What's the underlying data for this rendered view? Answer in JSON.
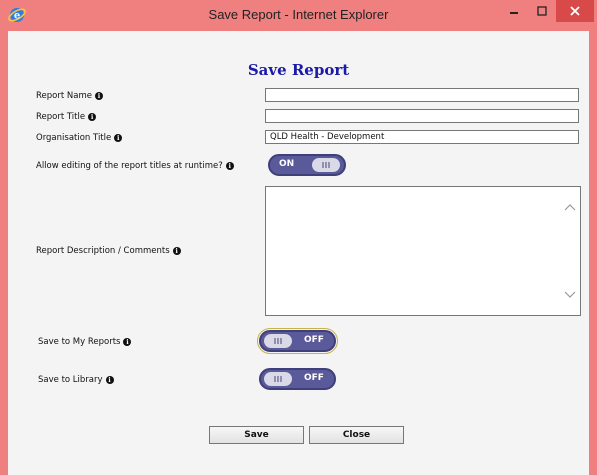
{
  "window": {
    "title": "Save Report - Internet Explorer",
    "frame_color": "#f08080",
    "close_color": "#d84a4a"
  },
  "form": {
    "title": "Save Report",
    "fields": {
      "report_name": {
        "label": "Report Name",
        "value": ""
      },
      "report_title": {
        "label": "Report Title",
        "value": ""
      },
      "organisation_title": {
        "label": "Organisation Title",
        "value": "QLD Health - Development"
      },
      "allow_editing": {
        "label": "Allow editing of the report titles at runtime?",
        "state": "ON"
      },
      "description": {
        "label": "Report Description / Comments",
        "value": ""
      },
      "save_to_my_reports": {
        "label": "Save to My Reports",
        "state": "OFF"
      },
      "save_to_library": {
        "label": "Save to Library",
        "state": "OFF"
      }
    },
    "info_glyph": "i",
    "toggle_knob_glyph": "III",
    "buttons": {
      "save": "Save",
      "close": "Close"
    }
  },
  "icons": [
    "internet-explorer-logo-icon",
    "minimize-icon",
    "maximize-icon",
    "close-icon",
    "info-icon",
    "scroll-up-icon",
    "scroll-down-icon"
  ],
  "colors": {
    "title_blue": "#1a1aa6",
    "toggle_bg": "#5a5a9a"
  }
}
